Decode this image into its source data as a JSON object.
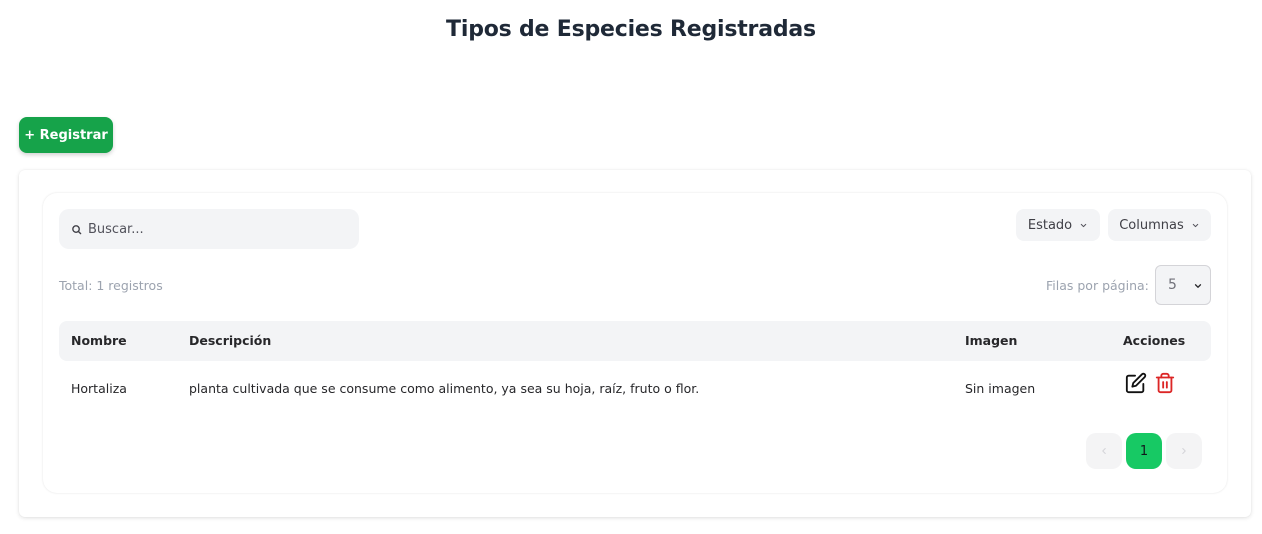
{
  "header": {
    "title": "Tipos de Especies Registradas"
  },
  "toolbar": {
    "register_label": "+ Registrar"
  },
  "search": {
    "placeholder": "Buscar...",
    "value": ""
  },
  "filters": {
    "estado_label": "Estado",
    "columnas_label": "Columnas"
  },
  "summary": {
    "total_text": "Total: 1 registros"
  },
  "pagination_controls": {
    "rows_label": "Filas por página:",
    "rows_value": "5",
    "current_page": "1"
  },
  "table": {
    "columns": [
      "Nombre",
      "Descripción",
      "Imagen",
      "Acciones"
    ],
    "rows": [
      {
        "nombre": "Hortaliza",
        "descripcion": "planta cultivada que se consume como alimento, ya sea su hoja, raíz, fruto o flor.",
        "imagen": "Sin imagen"
      }
    ]
  },
  "icons": {
    "search": "search-icon",
    "chevron": "chevron-down-icon",
    "edit": "edit-icon",
    "delete": "trash-icon",
    "prev": "chevron-left-icon",
    "next": "chevron-right-icon"
  },
  "colors": {
    "primary_green": "#16a34a",
    "page_active": "#17c964",
    "delete_red": "#dc2626",
    "header_bg": "#f3f4f6"
  }
}
